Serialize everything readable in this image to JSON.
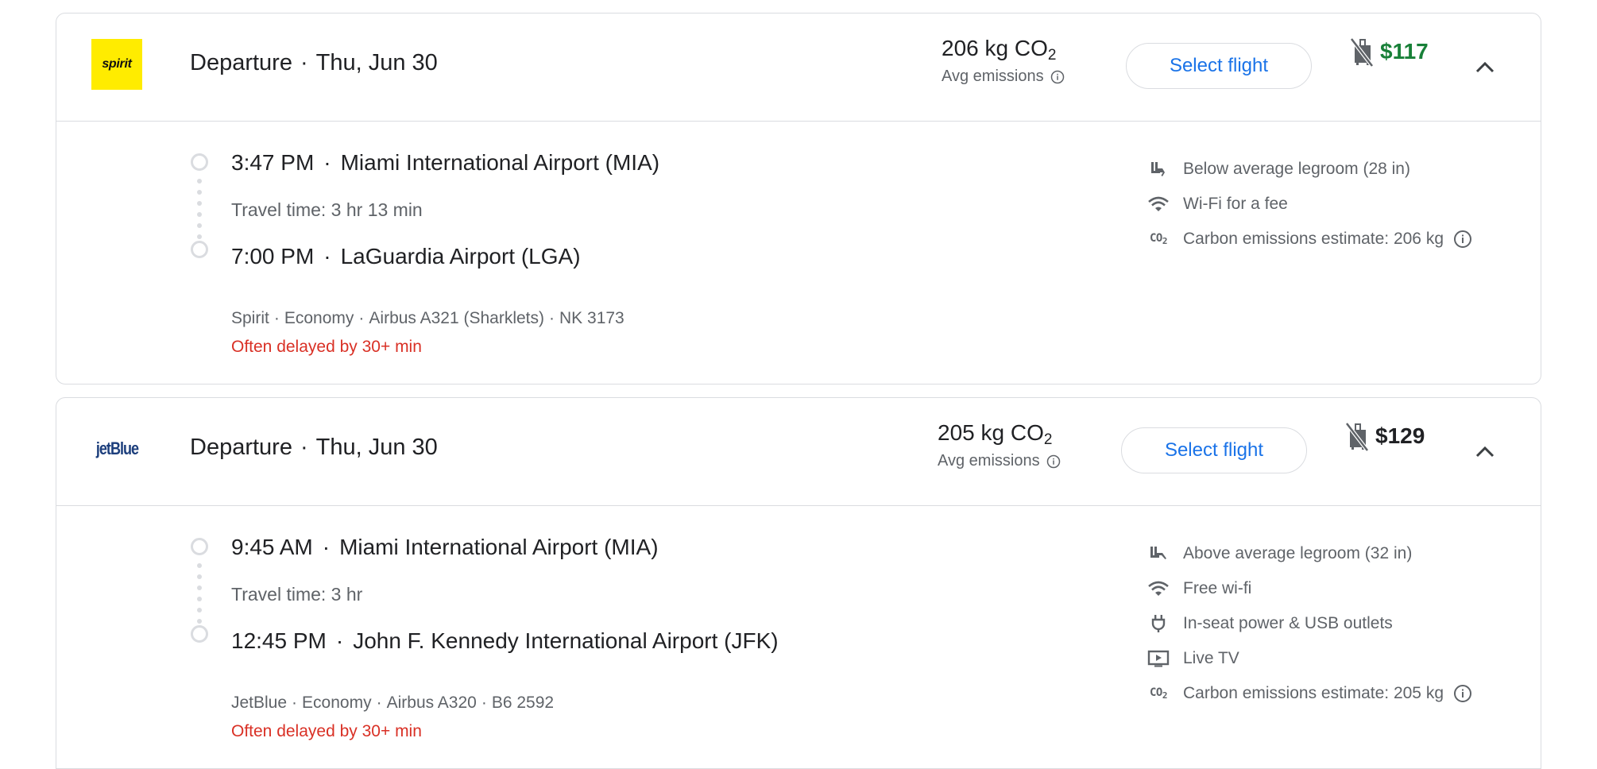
{
  "colors": {
    "price_low": "#188038",
    "price_normal": "#202124",
    "delay_red": "#d93025",
    "link_blue": "#1a73e8",
    "border_gray": "#dadce0",
    "secondary_text": "#5f6368",
    "spirit_yellow": "#ffec00",
    "jetblue_navy": "#1c3e7c"
  },
  "flights": [
    {
      "airline_logo": "spirit",
      "airline_logo_text": "spirit",
      "header": {
        "direction": "Departure",
        "separator": "·",
        "date": "Thu, Jun 30"
      },
      "emissions": {
        "value": "206 kg CO",
        "subscript": "2",
        "label": "Avg emissions",
        "info_icon": "info-icon"
      },
      "select_label": "Select flight",
      "price": "$117",
      "price_style": "low",
      "bag_icon": "no-carry-on-bag-icon",
      "collapse_icon": "chevron-up-icon",
      "legs": {
        "departure_time": "3:47 PM",
        "departure_airport": "Miami International Airport (MIA)",
        "travel_time": "Travel time: 3 hr 13 min",
        "arrival_time": "7:00 PM",
        "arrival_airport": "LaGuardia Airport (LGA)",
        "separator": "·"
      },
      "details": {
        "airline": "Spirit",
        "cabin": "Economy",
        "aircraft": "Airbus A321 (Sharklets)",
        "flight_number": "NK 3173",
        "separator": "·"
      },
      "delay_warning": "Often delayed by 30+ min",
      "amenities": [
        {
          "icon": "legroom-icon",
          "text": "Below average legroom (28 in)"
        },
        {
          "icon": "wifi-icon",
          "text": "Wi-Fi for a fee"
        },
        {
          "icon": "co2-icon",
          "text": "Carbon emissions estimate: 206 kg",
          "info": true
        }
      ]
    },
    {
      "airline_logo": "jetblue",
      "airline_logo_text": "jetBlue",
      "header": {
        "direction": "Departure",
        "separator": "·",
        "date": "Thu, Jun 30"
      },
      "emissions": {
        "value": "205 kg CO",
        "subscript": "2",
        "label": "Avg emissions",
        "info_icon": "info-icon"
      },
      "select_label": "Select flight",
      "price": "$129",
      "price_style": "normal",
      "bag_icon": "no-carry-on-bag-icon",
      "collapse_icon": "chevron-up-icon",
      "legs": {
        "departure_time": "9:45 AM",
        "departure_airport": "Miami International Airport (MIA)",
        "travel_time": "Travel time: 3 hr",
        "arrival_time": "12:45 PM",
        "arrival_airport": "John F. Kennedy International Airport (JFK)",
        "separator": "·"
      },
      "details": {
        "airline": "JetBlue",
        "cabin": "Economy",
        "aircraft": "Airbus A320",
        "flight_number": "B6 2592",
        "separator": "·"
      },
      "delay_warning": "Often delayed by 30+ min",
      "amenities": [
        {
          "icon": "legroom-icon",
          "text": "Above average legroom (32 in)"
        },
        {
          "icon": "wifi-icon",
          "text": "Free wi-fi"
        },
        {
          "icon": "power-outlet-icon",
          "text": "In-seat power & USB outlets"
        },
        {
          "icon": "live-tv-icon",
          "text": "Live TV"
        },
        {
          "icon": "co2-icon",
          "text": "Carbon emissions estimate: 205 kg",
          "info": true
        }
      ]
    }
  ]
}
